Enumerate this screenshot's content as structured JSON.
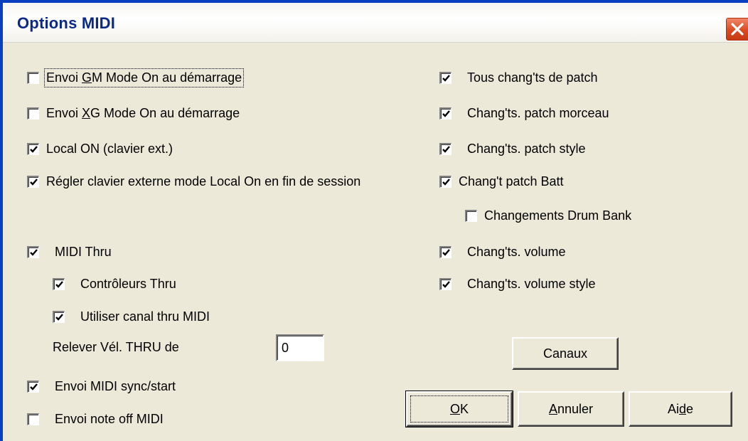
{
  "window": {
    "title": "Options MIDI"
  },
  "left_options": [
    {
      "pre": "Envoi ",
      "acc": "G",
      "post": "M Mode On au démarrage",
      "checked": false
    },
    {
      "pre": "Envoi ",
      "acc": "X",
      "post": "G Mode On au démarrage",
      "checked": false
    },
    {
      "pre": "",
      "acc": "",
      "post": "Local ON (clavier ext.)",
      "checked": true
    },
    {
      "pre": "",
      "acc": "",
      "post": "Régler clavier externe mode Local On en fin de session",
      "checked": true
    },
    {
      "pre": "",
      "acc": "",
      "post": "MIDI Thru",
      "checked": true
    },
    {
      "pre": "",
      "acc": "",
      "post": "Contrôleurs Thru",
      "checked": true
    },
    {
      "pre": "",
      "acc": "",
      "post": "Utiliser canal thru MIDI",
      "checked": true
    },
    {
      "pre": "",
      "acc": "",
      "post": "Envoi MIDI sync/start",
      "checked": true
    },
    {
      "pre": "",
      "acc": "",
      "post": "Envoi note off MIDI",
      "checked": false
    }
  ],
  "right_options": [
    {
      "label": "Tous chang'ts de patch",
      "checked": true
    },
    {
      "label": "Chang'ts. patch morceau",
      "checked": true
    },
    {
      "label": "Chang'ts. patch style",
      "checked": true
    },
    {
      "label": "Chang't patch Batt",
      "checked": true
    },
    {
      "label": "Changements Drum Bank",
      "checked": false
    },
    {
      "label": "Chang'ts. volume",
      "checked": true
    },
    {
      "label": "Chang'ts. volume style",
      "checked": true
    }
  ],
  "velocity": {
    "label": "Relever Vél. THRU de",
    "value": "0"
  },
  "buttons": {
    "channels": "Canaux",
    "ok": {
      "pre": "",
      "acc": "O",
      "post": "K"
    },
    "cancel": {
      "pre": "",
      "acc": "A",
      "post": "nnuler"
    },
    "help": {
      "pre": "Ai",
      "acc": "d",
      "post": "e"
    }
  },
  "icons": {
    "close": "close-icon",
    "check": "checkmark-icon"
  },
  "colors": {
    "dialog_bg": "#ece9d8",
    "title_text": "#0a2a86",
    "close_button": "#d94a22"
  }
}
